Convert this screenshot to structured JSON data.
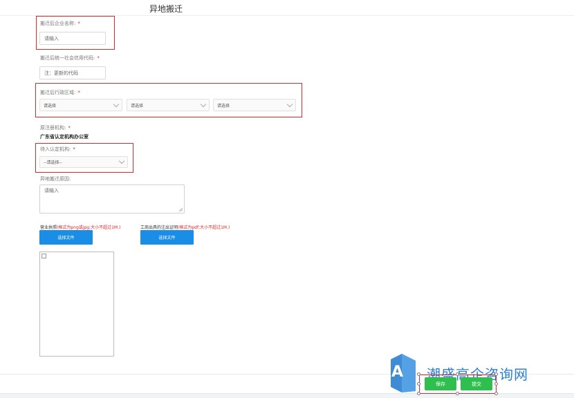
{
  "header": {
    "title": "异地搬迁"
  },
  "form": {
    "company_name": {
      "label": "搬迁后企业名称:",
      "required": "*",
      "placeholder": "请输入"
    },
    "credit_code": {
      "label": "搬迁后统一社会信用代码:",
      "required": "*",
      "placeholder": "注：更新的代码"
    },
    "region": {
      "label": "搬迁后行政区域:",
      "required": "*",
      "selects": [
        "请选择",
        "请选择",
        "请选择"
      ]
    },
    "original_agency": {
      "label": "原注册机构:",
      "required": "*",
      "value": "广东省认定机构办公室"
    },
    "target_agency": {
      "label": "待入认定机构:",
      "required": "*",
      "select_value": "--请选择--"
    },
    "reason": {
      "label": "异地搬迁原因:",
      "placeholder": "请输入"
    },
    "license_upload": {
      "label": "营业执照",
      "hint": "(格式为png或jpg;大小不超过1M.)",
      "button": "选择文件"
    },
    "cancel_upload": {
      "label": "工商出具的注出证明",
      "hint": "(格式为pdf;大小不超过1M.)",
      "button": "选择文件"
    }
  },
  "footer": {
    "save": "保存",
    "submit": "提交"
  },
  "watermark": {
    "text": "潮盛高企咨询网",
    "logo_letter": "A"
  },
  "colors": {
    "accent_blue": "#1a8ee6",
    "green": "#2fbf4f",
    "highlight_red": "#e0282c",
    "required_red": "#e02020"
  }
}
